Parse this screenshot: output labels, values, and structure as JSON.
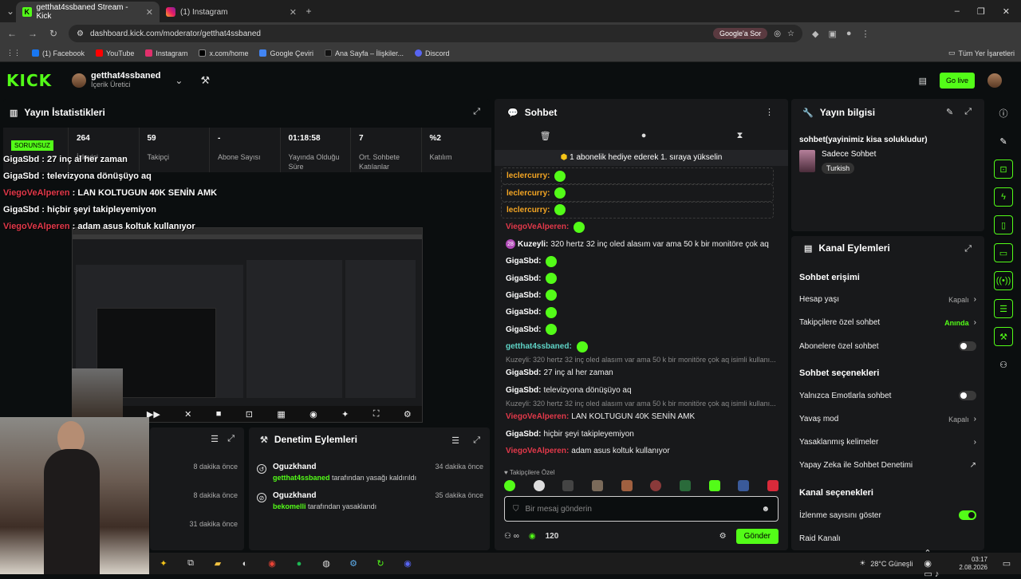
{
  "browser": {
    "tabs": [
      {
        "label": "getthat4ssbaned Stream - Kick",
        "active": true
      },
      {
        "label": "(1) Instagram",
        "active": false
      }
    ],
    "url": "dashboard.kick.com/moderator/getthat4ssbaned",
    "ask_google": "Google'a Sor",
    "bookmarks": [
      "(1) Facebook",
      "YouTube",
      "Instagram",
      "x.com/home",
      "Google Çeviri",
      "Ana Sayfa – İlişkiler...",
      "Discord"
    ],
    "all_bookmarks": "Tüm Yer İşaretleri"
  },
  "header": {
    "logo": "KICK",
    "channel_name": "getthat4ssbaned",
    "channel_role": "İçerik Üretici",
    "go_live": "Go live"
  },
  "stats": {
    "title": "Yayın İstatistikleri",
    "issue_badge": "SORUNSUZ",
    "items": [
      {
        "value": "264",
        "label": "İzleyici"
      },
      {
        "value": "59",
        "label": "Takipçi"
      },
      {
        "value": "-",
        "label": "Abone Sayısı"
      },
      {
        "value": "01:18:58",
        "label": "Yayında Olduğu Süre"
      },
      {
        "value": "7",
        "label": "Ort. Sohbete Katılanlar"
      },
      {
        "value": "%2",
        "label": "Katılım"
      }
    ]
  },
  "overlay_chat": [
    {
      "user": "GigaSbd",
      "text": ": 27 inç al her zaman",
      "red": false
    },
    {
      "user": "GigaSbd",
      "text": ": televizyona dönüşüyo aq",
      "red": false
    },
    {
      "user": "ViegoVeAlperen",
      "text": ": LAN KOLTUGUN 40K SENİN AMK",
      "red": true
    },
    {
      "user": "GigaSbd",
      "text": ": hiçbir şeyi takipleyemiyon",
      "red": false
    },
    {
      "user": "ViegoVeAlperen",
      "text": ": adam asus koltuk kullanıyor",
      "red": true
    }
  ],
  "left_mini": {
    "times": [
      "8 dakika önce",
      "8 dakika önce",
      "31 dakika önce"
    ]
  },
  "moderation": {
    "title": "Denetim Eylemleri",
    "actions": [
      {
        "moderator": "Oguzkhand",
        "target": "getthat4ssbaned",
        "text": "tarafından yasağı kaldırıldı",
        "time": "34 dakika önce"
      },
      {
        "moderator": "Oguzkhand",
        "target": "bekomelli",
        "text": "tarafından yasaklandı",
        "time": "35 dakika önce"
      }
    ]
  },
  "chat": {
    "title": "Sohbet",
    "pinned": "1 abonelik hediye ederek 1. sıraya yükselin",
    "messages": [
      {
        "user": "leclercurry:",
        "color": "orange",
        "text": "",
        "emote": true,
        "box": true
      },
      {
        "user": "leclercurry:",
        "color": "orange",
        "text": "",
        "emote": true,
        "box": true
      },
      {
        "user": "leclercurry:",
        "color": "orange",
        "text": "",
        "emote": true,
        "box": true
      },
      {
        "user": "ViegoVeAlperen:",
        "color": "red",
        "text": "",
        "emote": true,
        "box": false
      },
      {
        "user": "Kuzeyli:",
        "color": "white",
        "text": "320 hertz 32 inç oled alasım var ama 50 k bir monitöre çok aq",
        "emote": false,
        "box": false,
        "level": "28"
      },
      {
        "user": "GigaSbd:",
        "color": "white",
        "text": "",
        "emote": true,
        "box": false
      },
      {
        "user": "GigaSbd:",
        "color": "white",
        "text": "",
        "emote": true,
        "box": false
      },
      {
        "user": "GigaSbd:",
        "color": "white",
        "text": "",
        "emote": true,
        "box": false
      },
      {
        "user": "GigaSbd:",
        "color": "white",
        "text": "",
        "emote": true,
        "box": false
      },
      {
        "user": "GigaSbd:",
        "color": "white",
        "text": "",
        "emote": true,
        "box": false
      },
      {
        "user": "getthat4ssbaned:",
        "color": "cyan",
        "text": "",
        "emote": true,
        "box": false
      },
      {
        "reply": "Kuzeyli: 320 hertz 32 inç oled alasım var ama 50 k bir monitöre çok aq isimli kullanı..."
      },
      {
        "user": "GigaSbd:",
        "color": "white",
        "text": "27 inç al her zaman",
        "emote": false,
        "box": false
      },
      {
        "user": "GigaSbd:",
        "color": "white",
        "text": "televizyona dönüşüyo aq",
        "emote": false,
        "box": false
      },
      {
        "reply": "Kuzeyli: 320 hertz 32 inç oled alasım var ama 50 k bir monitöre çok aq isimli kullanı..."
      },
      {
        "user": "ViegoVeAlperen:",
        "color": "red",
        "text": "LAN KOLTUGUN 40K SENİN AMK",
        "emote": false,
        "box": false
      },
      {
        "user": "GigaSbd:",
        "color": "white",
        "text": "hiçbir şeyi takipleyemiyon",
        "emote": false,
        "box": false
      },
      {
        "user": "ViegoVeAlperen:",
        "color": "red",
        "text": "adam asus koltuk kullanıyor",
        "emote": false,
        "box": false
      }
    ],
    "followers_only": "Takipçilere Özel",
    "input_placeholder": "Bir mesaj gönderin",
    "points": "120",
    "send": "Gönder"
  },
  "info": {
    "title": "Yayın bilgisi",
    "stream_title": "sohbet(yayinimiz kisa solukludur)",
    "category": "Sadece Sohbet",
    "tag": "Turkish"
  },
  "channel_actions": {
    "title": "Kanal Eylemleri",
    "sections": [
      {
        "heading": "Sohbet erişimi",
        "rows": [
          {
            "label": "Hesap yaşı",
            "value": "Kapalı",
            "type": "arrow"
          },
          {
            "label": "Takipçilere özel sohbet",
            "value": "Anında",
            "type": "arrow",
            "green": true
          },
          {
            "label": "Abonelere özel sohbet",
            "value": "",
            "type": "toggle",
            "on": false
          }
        ]
      },
      {
        "heading": "Sohbet seçenekleri",
        "rows": [
          {
            "label": "Yalnızca Emotlarla sohbet",
            "value": "",
            "type": "toggle",
            "on": false
          },
          {
            "label": "Yavaş mod",
            "value": "Kapalı",
            "type": "arrow"
          },
          {
            "label": "Yasaklanmış kelimeler",
            "value": "",
            "type": "arrow"
          },
          {
            "label": "Yapay Zeka ile Sohbet Denetimi",
            "value": "",
            "type": "external"
          }
        ]
      },
      {
        "heading": "Kanal seçenekleri",
        "rows": [
          {
            "label": "İzlenme sayısını göster",
            "value": "",
            "type": "toggle",
            "on": true
          },
          {
            "label": "Raid Kanalı",
            "value": "",
            "type": "none"
          }
        ]
      }
    ]
  },
  "taskbar": {
    "weather": "28°C Güneşli",
    "time": "03:17",
    "date": "2.08.2026"
  }
}
